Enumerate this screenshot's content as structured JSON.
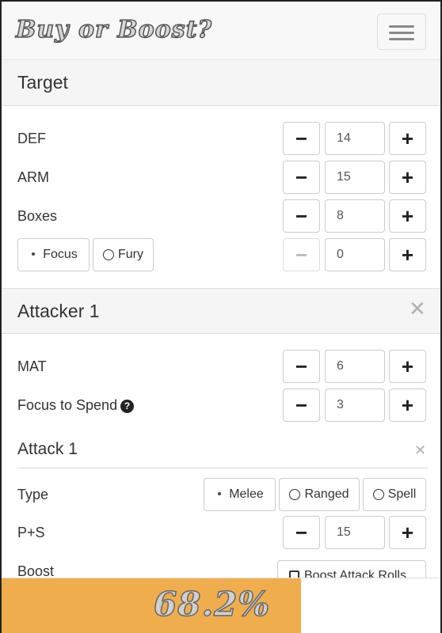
{
  "app": {
    "brand": "Buy or Boost?"
  },
  "target": {
    "title": "Target",
    "rows": [
      {
        "label": "DEF",
        "value": "14"
      },
      {
        "label": "ARM",
        "value": "15"
      },
      {
        "label": "Boxes",
        "value": "8"
      }
    ],
    "resource": {
      "options": [
        "Focus",
        "Fury"
      ],
      "selected": "Focus",
      "value": "0"
    }
  },
  "attacker": {
    "title": "Attacker 1",
    "rows": [
      {
        "label": "MAT",
        "value": "6"
      },
      {
        "label": "Focus to Spend",
        "value": "3"
      }
    ],
    "attack": {
      "title": "Attack 1",
      "type_label": "Type",
      "types": [
        "Melee",
        "Ranged",
        "Spell"
      ],
      "selected": "Melee",
      "ps_label": "P+S",
      "ps_value": "15",
      "boost_label": "Boost",
      "boost_option": "Boost Attack Rolls"
    }
  },
  "result": {
    "text": "68.2%",
    "fraction": 0.682
  },
  "icons": {
    "minus": "minus-icon",
    "plus": "plus-icon",
    "close": "close-icon",
    "help": "question-circle-icon",
    "menu": "hamburger-icon"
  },
  "colors": {
    "progress": "#f0ad4e",
    "header_bg": "#f5f5f5"
  }
}
